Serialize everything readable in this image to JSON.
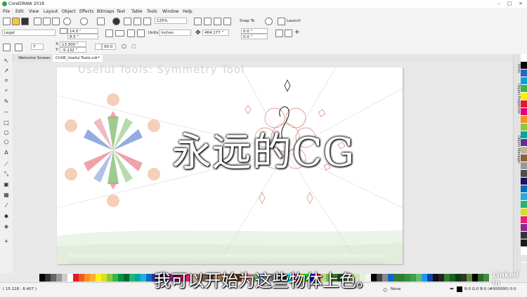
{
  "window": {
    "title": "CorelDRAW 2018"
  },
  "menu": [
    "File",
    "Edit",
    "View",
    "Layout",
    "Object",
    "Effects",
    "Bitmaps",
    "Text",
    "Table",
    "Tools",
    "Window",
    "Help"
  ],
  "toolbar1": {
    "zoom": "125%",
    "snap_label": "Snap To",
    "launch_label": "Launch"
  },
  "toolbar2": {
    "page_size": "Legal",
    "width": "14.0 \"",
    "height": "8.5 \"",
    "units_label": "Units:",
    "units": "inches",
    "nudge": "464.177 \"",
    "dup_x": "0.0 \"",
    "dup_y": "0.0 \""
  },
  "toolbar3": {
    "points": "7",
    "x": "13.900 \"",
    "y": "-5.132 \"",
    "size": "0.0 \"",
    "opacity": "90.0"
  },
  "tabs": [
    {
      "label": "Welcome Screen"
    },
    {
      "label": "Ch08_Useful Tools.cdr*"
    }
  ],
  "canvas": {
    "faint_heading": "Useful Tools: Symmetry Tool"
  },
  "docker": {
    "tabs": [
      "Hints",
      "Object Properties",
      "Object Manager"
    ]
  },
  "status": {
    "coords": "( 15.118 , 6.407 )",
    "fill": "None",
    "outline": "R:0 G:0 B:0 (#000000) 0.0"
  },
  "overlay": {
    "watermark": "永远的CG",
    "subtitle": "我可以开始为这些物体上色。",
    "brand": "Linked in"
  },
  "colors": {
    "accent": "#2e7bd6",
    "petal_green": "#7dbb6a",
    "petal_pink": "#e8838c",
    "petal_blue": "#6f8fd6",
    "circle": "#f2c3a8",
    "drawing_line": "#c75a4a"
  }
}
